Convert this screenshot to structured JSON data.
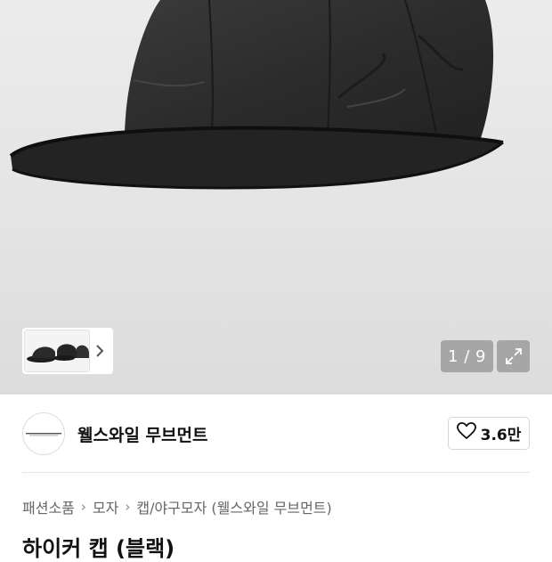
{
  "gallery": {
    "counter": "1 / 9",
    "thumbnail_alt": "black-cap-thumbnails"
  },
  "brand": {
    "name": "웰스와일 무브먼트",
    "like_count": "3.6만"
  },
  "breadcrumb": [
    "패션소품",
    "모자",
    "캡/야구모자 (웰스와일 무브먼트)"
  ],
  "product": {
    "title": "하이커 캡 (블랙)"
  },
  "colors": {
    "hero_bg": "#e6e6e6",
    "cap": "#2a2a2a",
    "overlay": "#808080"
  },
  "icons": {
    "thumb_next": "chevron-right-icon",
    "expand": "expand-icon",
    "like": "heart-outline-icon"
  }
}
